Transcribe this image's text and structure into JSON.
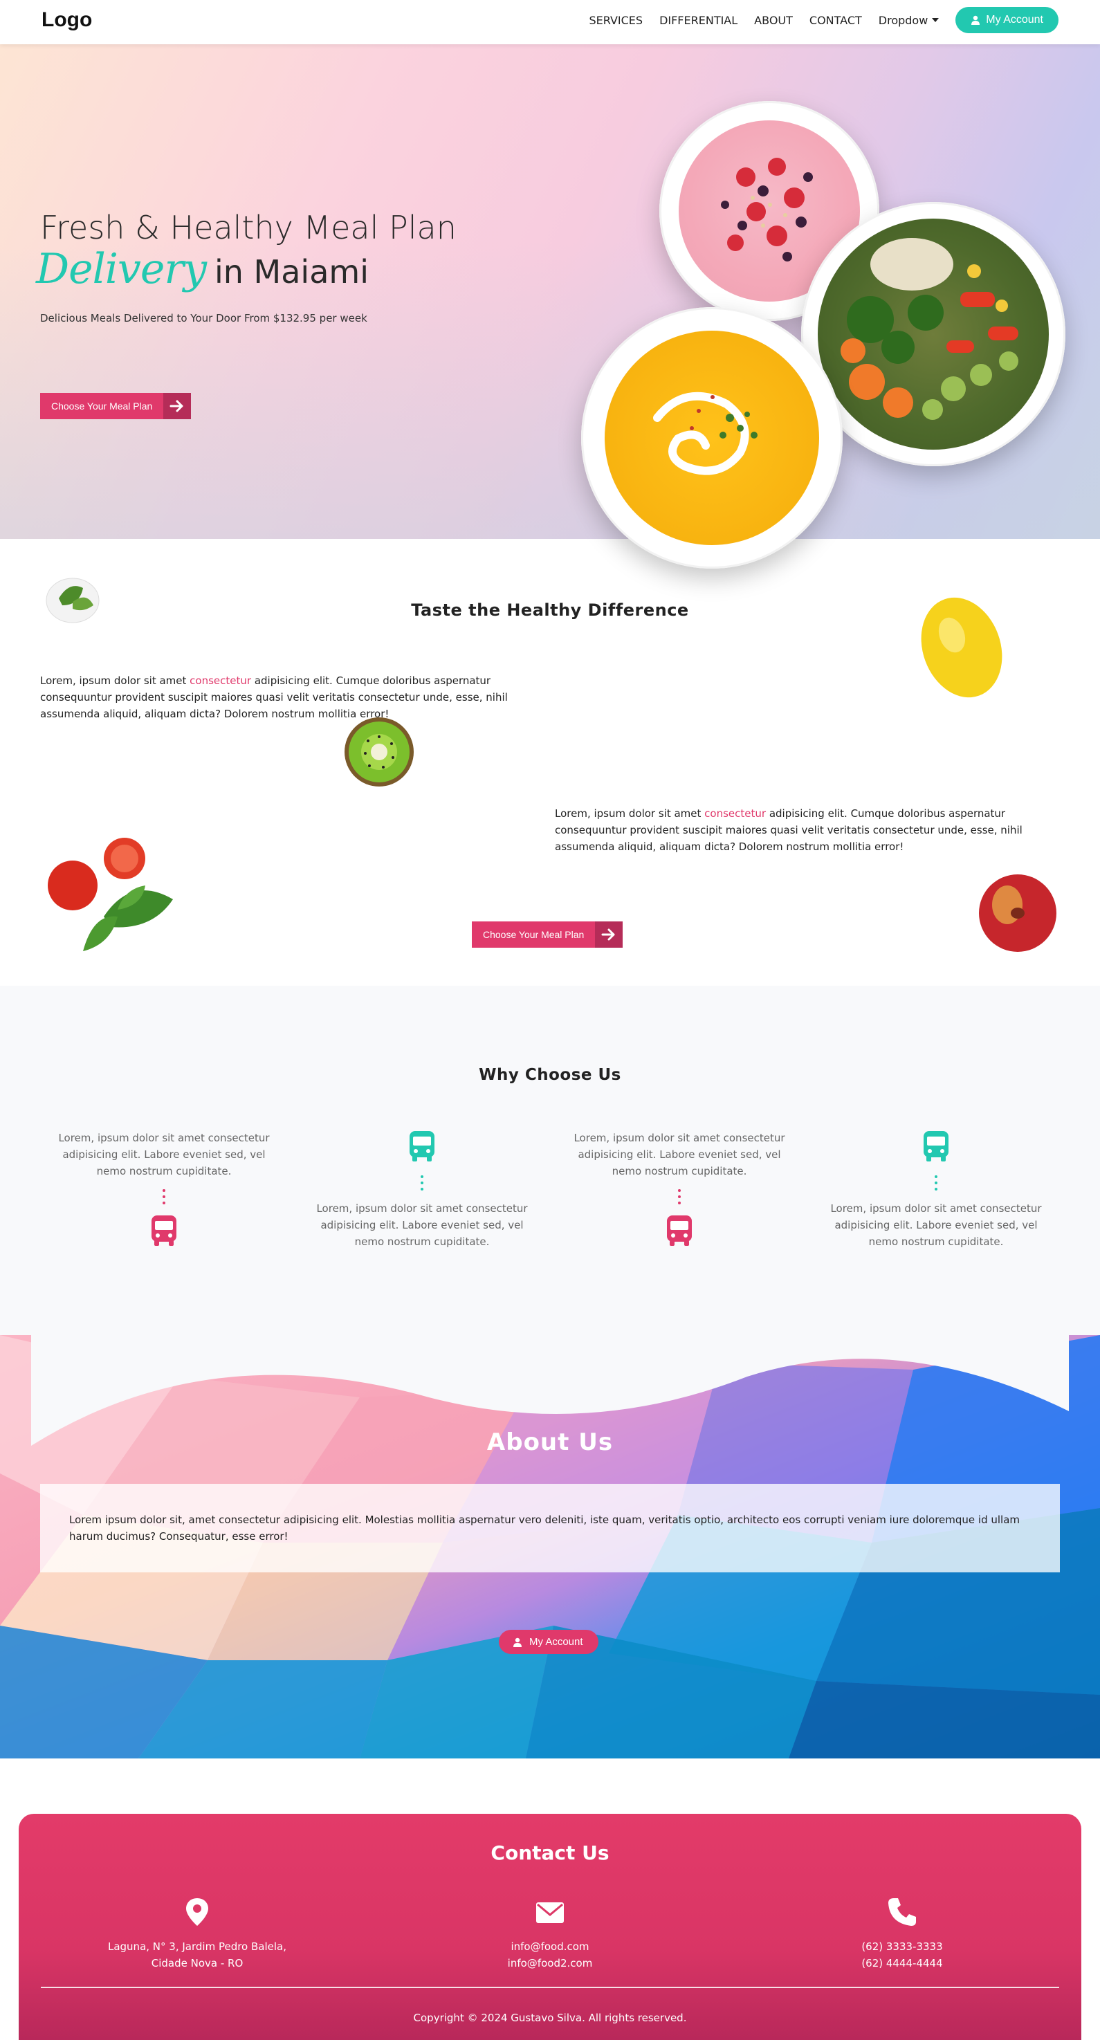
{
  "nav": {
    "logo": "Logo",
    "links": [
      "SERVICES",
      "DIFFERENTIAL",
      "ABOUT",
      "CONTACT"
    ],
    "dropdown": "Dropdow",
    "account": "My Account"
  },
  "hero": {
    "title_line1": "Fresh & Healthy Meal Plan",
    "title_script": "Delivery",
    "title_line2": "in Maiami",
    "subtitle": "Delicious Meals Delivered to Your Door From $132.95 per week",
    "cta": "Choose Your Meal Plan"
  },
  "taste": {
    "title": "Taste the Healthy Difference",
    "para1": {
      "before": "Lorem, ipsum dolor sit amet ",
      "highlight": "consectetur",
      "after": " adipisicing elit. Cumque doloribus aspernatur consequuntur provident suscipit maiores quasi velit veritatis consectetur unde, esse, nihil assumenda aliquid, aliquam dicta? Dolorem nostrum mollitia error!"
    },
    "para2": {
      "before": "Lorem, ipsum dolor sit amet ",
      "highlight": "consectetur",
      "after": " adipisicing elit. Cumque doloribus aspernatur consequuntur provident suscipit maiores quasi velit veritatis consectetur unde, esse, nihil assumenda aliquid, aliquam dicta? Dolorem nostrum mollitia error!"
    },
    "cta": "Choose Your Meal Plan"
  },
  "why": {
    "title": "Why Choose Us",
    "items": [
      {
        "text": "Lorem, ipsum dolor sit amet consectetur adipisicing elit. Labore eveniet sed, vel nemo nostrum cupiditate.",
        "color": "#e0396b"
      },
      {
        "text": "Lorem, ipsum dolor sit amet consectetur adipisicing elit. Labore eveniet sed, vel nemo nostrum cupiditate.",
        "color": "#22c8b0"
      },
      {
        "text": "Lorem, ipsum dolor sit amet consectetur adipisicing elit. Labore eveniet sed, vel nemo nostrum cupiditate.",
        "color": "#e0396b"
      },
      {
        "text": "Lorem, ipsum dolor sit amet consectetur adipisicing elit. Labore eveniet sed, vel nemo nostrum cupiditate.",
        "color": "#22c8b0"
      }
    ]
  },
  "about": {
    "title": "About Us",
    "text": "Lorem ipsum dolor sit, amet consectetur adipisicing elit. Molestias mollitia aspernatur vero deleniti, iste quam, veritatis optio, architecto eos corrupti veniam iure doloremque id ullam harum ducimus? Consequatur, esse error!",
    "button": "My Account"
  },
  "contact": {
    "title": "Contact Us",
    "address_line1": "Laguna, N° 3, Jardim Pedro Balela,",
    "address_line2": "Cidade Nova - RO",
    "email1": "info@food.com",
    "email2": "info@food2.com",
    "phone1": "(62) 3333-3333",
    "phone2": "(62) 4444-4444",
    "copyright": "Copyright © 2024 Gustavo Silva. All rights reserved."
  },
  "colors": {
    "primary_pink": "#e0396b",
    "accent_teal": "#22c8b0"
  },
  "icons": [
    "user-icon",
    "caret-down-icon",
    "arrow-right-icon",
    "bus-icon",
    "map-pin-icon",
    "envelope-icon",
    "phone-icon"
  ]
}
